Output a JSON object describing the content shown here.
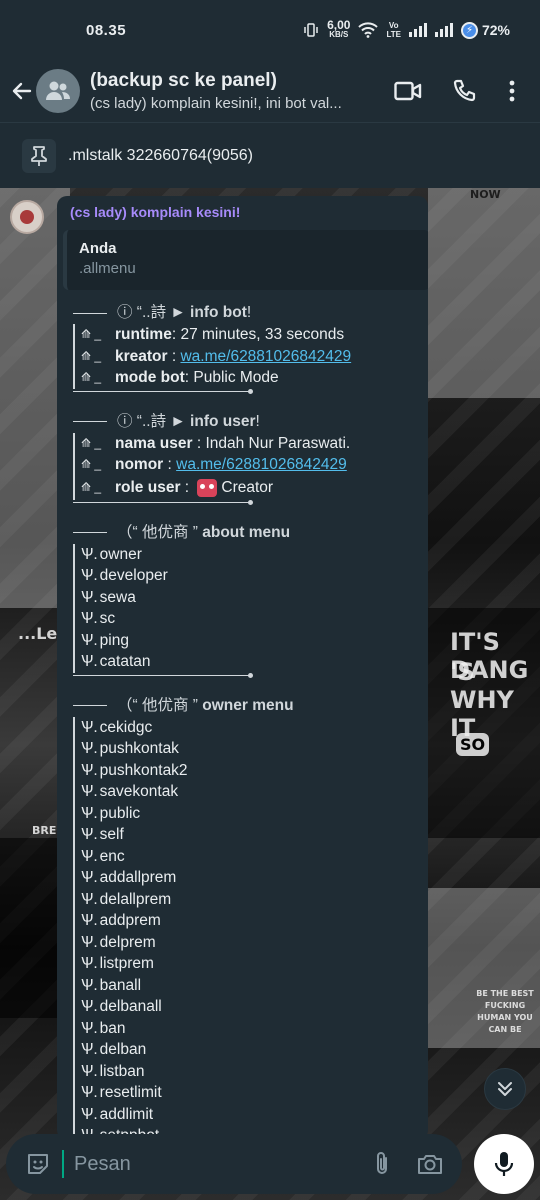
{
  "status_bar": {
    "time": "08.35",
    "net_speed_value": "6,00",
    "net_speed_unit": "KB/S",
    "volte_top": "Vo",
    "volte_bottom": "LTE",
    "battery": "72%"
  },
  "header": {
    "title": "(backup sc ke panel)",
    "subtitle": "(cs lady) komplain kesini!, ini bot val..."
  },
  "pinned": {
    "text": ".mlstalk 322660764(9056)"
  },
  "background": {
    "text_1": "IT'S DANG",
    "text_2": "'S WHY IT",
    "text_3": "...Le",
    "text_4": "BE THE BEST FUCKING HUMAN YOU CAN BE",
    "text_5": "SO",
    "text_6": "NOW",
    "text_7": "BREE"
  },
  "message": {
    "sender": "(cs lady) komplain kesini!",
    "quote": {
      "name": "Anda",
      "text": ".allmenu"
    },
    "info_bot": {
      "header_prefix": "ⓘ “..詩 ►",
      "header_title": "info bot",
      "header_suffix": "!",
      "rows": [
        {
          "sym": "⟰ _",
          "key": "runtime",
          "value": " : 27 minutes, 33 seconds"
        },
        {
          "sym": "⟰ _",
          "key": "kreator",
          "value": " : ",
          "link": "wa.me/62881026842429"
        },
        {
          "sym": "⟰ _",
          "key": "mode bot",
          "value": " : Public Mode"
        }
      ]
    },
    "info_user": {
      "header_prefix": "ⓘ “..詩 ►",
      "header_title": "info user",
      "header_suffix": "!",
      "rows": [
        {
          "sym": "⟰ _",
          "key": "nama user",
          "value": " : Indah Nur Paraswati."
        },
        {
          "sym": "⟰ _",
          "key": "nomor",
          "value": " : ",
          "link": "wa.me/62881026842429"
        },
        {
          "sym": "⟰ _",
          "key": "role user",
          "value": " : ",
          "value2": "Creator"
        }
      ]
    },
    "about_menu": {
      "header_prefix": "（“ 他优商 ”",
      "header_title": "about menu",
      "bullet": "Ѱ.",
      "items": [
        "owner",
        "developer",
        "sewa",
        "sc",
        "ping",
        "catatan"
      ]
    },
    "owner_menu": {
      "header_prefix": "（“ 他优商 ”",
      "header_title": "owner menu",
      "bullet": "Ѱ.",
      "items": [
        "cekidgc",
        "pushkontak",
        "pushkontak2",
        "savekontak",
        "public",
        "self",
        "enc",
        "addallprem",
        "delallprem",
        "addprem",
        "delprem",
        "listprem",
        "banall",
        "delbanall",
        "ban",
        "delban",
        "listban",
        "resetlimit",
        "addlimit",
        "setppbot"
      ]
    }
  },
  "input": {
    "placeholder": "Pesan"
  },
  "colors": {
    "app_bar": "#1f2c34",
    "bubble": "#1f2c34",
    "link": "#53bdeb",
    "sender_name": "#a78bfa",
    "accent": "#00a884"
  }
}
